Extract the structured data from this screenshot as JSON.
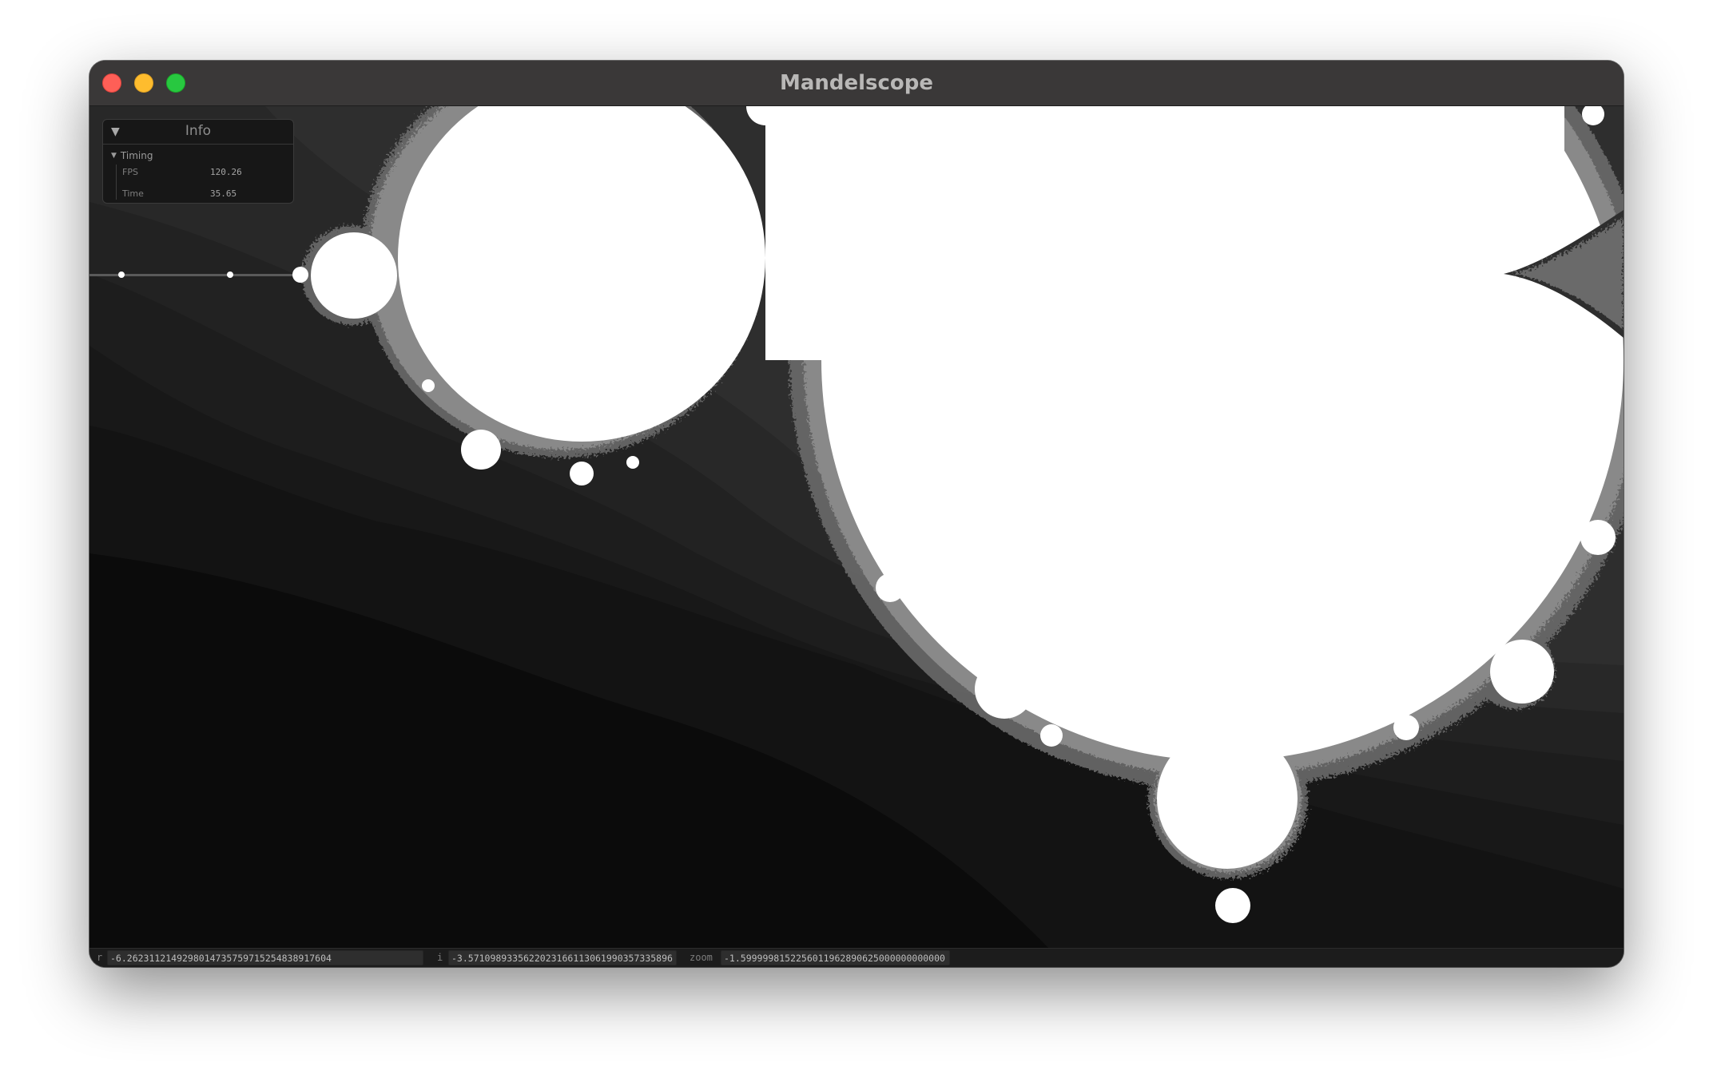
{
  "window": {
    "title": "Mandelscope"
  },
  "info_panel": {
    "toggle_glyph": "▼",
    "title": "Info",
    "section": {
      "toggle_glyph": "▼",
      "label": "Timing"
    },
    "metrics": [
      {
        "label": "FPS",
        "value": "120.26"
      },
      {
        "label": "Time",
        "value": "35.65"
      }
    ]
  },
  "status_bar": {
    "r_label": "r",
    "r_value": "-6.262311214929801473575971525483891760​4",
    "i_label": "i",
    "i_value": "-3.571098933562202316611306199035733589​6",
    "zoom_label": "zoom",
    "zoom_value": "-1.5999998152256011962890625000000000000"
  },
  "colors": {
    "titlebar": "#3a3838",
    "canvas_background": "#0b0b0b",
    "set_fill": "#ffffff",
    "close": "#fe5f57",
    "minimize": "#febc2e",
    "zoom": "#28c840"
  }
}
